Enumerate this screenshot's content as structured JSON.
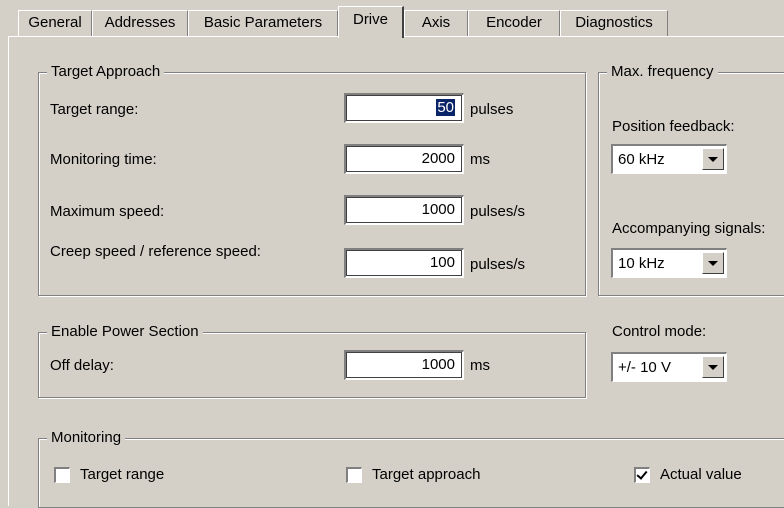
{
  "tabs": [
    "General",
    "Addresses",
    "Basic Parameters",
    "Drive",
    "Axis",
    "Encoder",
    "Diagnostics"
  ],
  "active_tab": "Drive",
  "target_approach": {
    "title": "Target Approach",
    "target_range": {
      "label": "Target range:",
      "value": "50",
      "unit": "pulses"
    },
    "monitoring_time": {
      "label": "Monitoring time:",
      "value": "2000",
      "unit": "ms"
    },
    "maximum_speed": {
      "label": "Maximum speed:",
      "value": "1000",
      "unit": "pulses/s"
    },
    "creep_speed": {
      "label": "Creep speed / reference speed:",
      "value": "100",
      "unit": "pulses/s"
    }
  },
  "max_frequency": {
    "title": "Max. frequency",
    "position_feedback": {
      "label": "Position feedback:",
      "value": "60 kHz"
    },
    "accompanying_signals": {
      "label": "Accompanying signals:",
      "value": "10 kHz"
    }
  },
  "enable_power_section": {
    "title": "Enable Power Section",
    "off_delay": {
      "label": "Off delay:",
      "value": "1000",
      "unit": "ms"
    }
  },
  "control_mode": {
    "label": "Control mode:",
    "value": "+/- 10 V"
  },
  "monitoring": {
    "title": "Monitoring",
    "target_range": {
      "label": "Target range",
      "checked": false
    },
    "target_approach": {
      "label": "Target approach",
      "checked": false
    },
    "actual_value": {
      "label": "Actual value",
      "checked": true
    }
  },
  "colors": {
    "face": "#d4d0c8",
    "selection": "#0a246a"
  }
}
